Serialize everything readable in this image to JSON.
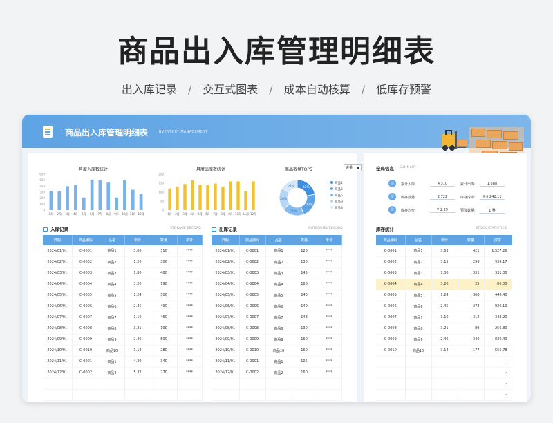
{
  "page": {
    "title": "商品出入库管理明细表",
    "features": [
      "出入库记录",
      "交互式图表",
      "成本自动核算",
      "低库存预警"
    ],
    "separator": "/"
  },
  "app": {
    "title": "商品出入库管理明细表",
    "subtitle": "INVENTORY MANAGEMENT"
  },
  "charts": {
    "inbound": {
      "title": "月度入库数统计"
    },
    "outbound": {
      "title": "月度出库数统计"
    },
    "top5": {
      "title": "商品数量TOP5",
      "select_value": "进量"
    }
  },
  "chart_data": [
    {
      "type": "bar",
      "title": "月度入库数统计",
      "categories": [
        "1月",
        "2月",
        "3月",
        "4月",
        "5月",
        "6月",
        "7月",
        "8月",
        "9月",
        "10月",
        "11月",
        "12月"
      ],
      "values": [
        320,
        310,
        400,
        420,
        210,
        510,
        500,
        460,
        210,
        500,
        340,
        270
      ],
      "ylim": [
        0,
        600
      ],
      "yticks": [
        "600",
        "500",
        "400",
        "300",
        "200",
        "100",
        "0"
      ],
      "color": "#7bb3e8"
    },
    {
      "type": "bar",
      "title": "月度出库数统计",
      "categories": [
        "1月",
        "2月",
        "3月",
        "4月",
        "5月",
        "6月",
        "7月",
        "8月",
        "9月",
        "10月",
        "11月",
        "12月"
      ],
      "values": [
        120,
        130,
        145,
        165,
        140,
        140,
        148,
        130,
        160,
        160,
        105,
        160
      ],
      "ylim": [
        0,
        200
      ],
      "yticks": [
        "200",
        "150",
        "100",
        "50",
        "0"
      ],
      "color": "#f2c12e"
    },
    {
      "type": "pie",
      "title": "商品数量TOP5",
      "labels": [
        "商品1",
        "商品6",
        "商品5",
        "商品9",
        "商品8"
      ],
      "values": [
        22,
        22,
        20,
        20,
        16
      ],
      "value_labels": [
        "22%",
        "22%",
        "20%",
        "20%",
        "16%"
      ],
      "colors": [
        "#3d8fe0",
        "#5ea3e4",
        "#8bbef0",
        "#b5d5f5",
        "#d6e8fa"
      ]
    }
  ],
  "inbound": {
    "title": "入库记录",
    "subtitle": "STORAGE RECORD",
    "columns": [
      "日期",
      "商品编码",
      "品名",
      "单价",
      "数量",
      "单号"
    ],
    "rows": [
      [
        "2024/01/01",
        "C-0001",
        "商品1",
        "3.00",
        "310",
        "****"
      ],
      [
        "2024/02/01",
        "C-0002",
        "商品2",
        "1.20",
        "300",
        "****"
      ],
      [
        "2024/03/01",
        "C-0003",
        "商品3",
        "1.80",
        "480",
        "****"
      ],
      [
        "2024/04/01",
        "C-0004",
        "商品4",
        "3.20",
        "190",
        "****"
      ],
      [
        "2024/05/01",
        "C-0005",
        "商品5",
        "1.24",
        "500",
        "****"
      ],
      [
        "2024/06/01",
        "C-0006",
        "商品6",
        "2.45",
        "490",
        "****"
      ],
      [
        "2024/07/01",
        "C-0007",
        "商品7",
        "1.10",
        "460",
        "****"
      ],
      [
        "2024/08/01",
        "C-0008",
        "商品8",
        "3.21",
        "190",
        "****"
      ],
      [
        "2024/09/01",
        "C-0009",
        "商品9",
        "2.46",
        "500",
        "****"
      ],
      [
        "2024/10/01",
        "C-0010",
        "商品10",
        "3.14",
        "280",
        "****"
      ],
      [
        "2024/11/01",
        "C-0001",
        "商品1",
        "4.20",
        "340",
        "****"
      ],
      [
        "2024/12/01",
        "C-0002",
        "商品2",
        "5.32",
        "270",
        "****"
      ]
    ]
  },
  "outbound": {
    "title": "出库记录",
    "subtitle": "OUTBOUND RECORD",
    "columns": [
      "日期",
      "商品编码",
      "品名",
      "数量",
      "单号"
    ],
    "rows": [
      [
        "2024/01/01",
        "C-0001",
        "商品1",
        "120",
        "****"
      ],
      [
        "2024/02/01",
        "C-0002",
        "商品2",
        "130",
        "****"
      ],
      [
        "2024/03/01",
        "C-0003",
        "商品3",
        "145",
        "****"
      ],
      [
        "2024/04/01",
        "C-0004",
        "商品4",
        "166",
        "****"
      ],
      [
        "2024/05/01",
        "C-0005",
        "商品5",
        "140",
        "****"
      ],
      [
        "2024/06/01",
        "C-0006",
        "商品6",
        "140",
        "****"
      ],
      [
        "2024/07/01",
        "C-0007",
        "商品7",
        "148",
        "****"
      ],
      [
        "2024/08/01",
        "C-0008",
        "商品8",
        "130",
        "****"
      ],
      [
        "2024/09/01",
        "C-0009",
        "商品9",
        "160",
        "****"
      ],
      [
        "2024/10/01",
        "C-0010",
        "商品10",
        "160",
        "****"
      ],
      [
        "2024/11/01",
        "C-0001",
        "商品1",
        "105",
        "****"
      ],
      [
        "2024/12/01",
        "C-0002",
        "商品2",
        "160",
        "****"
      ]
    ]
  },
  "summary": {
    "title": "全局信息",
    "subtitle": "SUMMARY",
    "items": [
      {
        "label": "累计入库:",
        "value": "4,310"
      },
      {
        "label": "累计出库:",
        "value": "1,588"
      },
      {
        "label": "库存数量:",
        "value": "2,722"
      },
      {
        "label": "库存成本:",
        "value": "¥ 6,242.11"
      },
      {
        "label": "库存均价:",
        "value": "¥ 2.29"
      },
      {
        "label": "预警数量:",
        "value": "1 整"
      }
    ]
  },
  "stock": {
    "title": "库存统计",
    "subtitle": "STOCK STATISTICS",
    "columns": [
      "商品编码",
      "品名",
      "单价",
      "数量",
      "成本"
    ],
    "rows": [
      [
        "C-0001",
        "商品1",
        "3.63",
        "421",
        "1,527.26"
      ],
      [
        "C-0002",
        "商品2",
        "3.15",
        "298",
        "939.17"
      ],
      [
        "C-0003",
        "商品3",
        "1.00",
        "331",
        "331.00"
      ],
      [
        "C-0004",
        "商品4",
        "3.20",
        "25",
        "80.00"
      ],
      [
        "C-0005",
        "商品5",
        "1.24",
        "360",
        "446.40"
      ],
      [
        "C-0006",
        "商品6",
        "2.45",
        "378",
        "926.10"
      ],
      [
        "C-0007",
        "商品7",
        "1.10",
        "312",
        "343.20"
      ],
      [
        "C-0008",
        "商品8",
        "3.21",
        "80",
        "256.80"
      ],
      [
        "C-0009",
        "商品9",
        "2.46",
        "340",
        "836.40"
      ],
      [
        "C-0010",
        "商品10",
        "3.14",
        "177",
        "555.78"
      ]
    ],
    "empty_cost": [
      "-",
      "-",
      "-",
      "-"
    ],
    "highlight_row": 3
  },
  "colors": {
    "accent": "#5ea3e4",
    "inbound_bar": "#7bb3e8",
    "outbound_bar": "#f2c12e",
    "highlight": "#fdf1c8"
  }
}
